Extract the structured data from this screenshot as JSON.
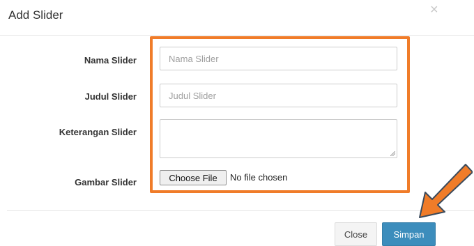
{
  "modal": {
    "title": "Add Slider",
    "close_glyph": "×"
  },
  "form": {
    "nama": {
      "label": "Nama Slider",
      "placeholder": "Nama Slider"
    },
    "judul": {
      "label": "Judul Slider",
      "placeholder": "Judul Slider"
    },
    "keterangan": {
      "label": "Keterangan Slider"
    },
    "gambar": {
      "label": "Gambar Slider",
      "button_label": "Choose File",
      "status": "No file chosen"
    }
  },
  "footer": {
    "close_label": "Close",
    "save_label": "Simpan"
  },
  "colors": {
    "highlight": "#f07c29",
    "primary": "#3c8dbc"
  },
  "icons": {
    "close": "close-icon",
    "pointer": "arrow-pointer-icon"
  }
}
